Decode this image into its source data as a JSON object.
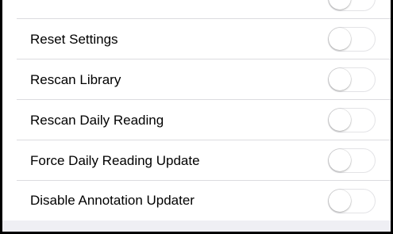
{
  "settings": {
    "items": [
      {
        "label": "",
        "toggle_on": false
      },
      {
        "label": "Reset Settings",
        "toggle_on": false
      },
      {
        "label": "Rescan Library",
        "toggle_on": false
      },
      {
        "label": "Rescan Daily Reading",
        "toggle_on": false
      },
      {
        "label": "Force Daily Reading Update",
        "toggle_on": false
      },
      {
        "label": "Disable Annotation Updater",
        "toggle_on": false
      }
    ]
  },
  "colors": {
    "separator": "#dcdce0",
    "toggle_border": "#e3e3e6",
    "footer_bg": "#efeff4"
  }
}
